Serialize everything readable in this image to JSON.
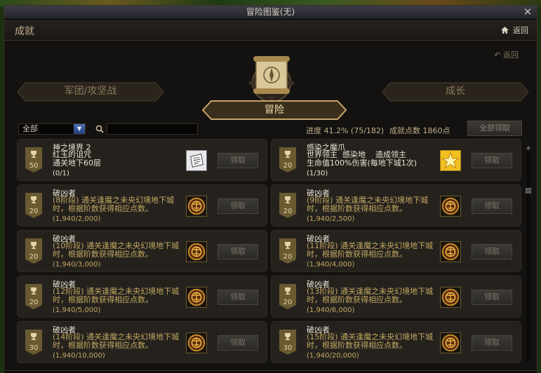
{
  "window": {
    "title": "冒险图鉴(无)"
  },
  "header": {
    "title": "成就",
    "home_label": "返回"
  },
  "return_small": "返回",
  "tabs": {
    "left": "军团/攻坚战",
    "center": "冒险",
    "right": "成长"
  },
  "filter": {
    "select_value": "全部",
    "search_placeholder": "",
    "progress_text": "进度 41.2% (75/182)",
    "points_text": "成就点数 1860点",
    "claim_all_label": "全部领取"
  },
  "cards": [
    {
      "title": "神之境界 2",
      "desc": "红玉的诅咒\n通关地下60层",
      "progress": "(0/1)",
      "points": "50",
      "reward": "scroll-reward-icon",
      "claim": "领取"
    },
    {
      "title": "感染之魔爪",
      "desc": "世界领主  感染地    造成领主\n生命值100%伤害(每地下城1次)",
      "progress": "(1/30)",
      "points": "20",
      "reward": "gold-star-reward-icon",
      "claim": "领取"
    },
    {
      "title": "破凶者",
      "desc": "(8阶段) 通关逢魔之未央幻境地下城时，根据阶数获得相应点数。",
      "progress": "(1,940/2,000)",
      "points": "20",
      "reward": "emblem-reward-icon",
      "claim": "领取"
    },
    {
      "title": "破凶者",
      "desc": "(9阶段) 通关逢魔之未央幻境地下城时，根据阶数获得相应点数。",
      "progress": "(1,940/2,500)",
      "points": "20",
      "reward": "emblem-reward-icon",
      "claim": "领取"
    },
    {
      "title": "破凶者",
      "desc": "(10阶段) 通关逢魔之未央幻境地下城时，根据阶数获得相应点数。",
      "progress": "(1,940/3,000)",
      "points": "20",
      "reward": "emblem-reward-icon",
      "claim": "领取"
    },
    {
      "title": "破凶者",
      "desc": "(11阶段) 通关逢魔之未央幻境地下城时，根据阶数获得相应点数。",
      "progress": "(1,940/4,000)",
      "points": "20",
      "reward": "emblem-reward-icon",
      "claim": "领取"
    },
    {
      "title": "破凶者",
      "desc": "(12阶段) 通关逢魔之未央幻境地下城时，根据阶数获得相应点数。",
      "progress": "(1,940/5,000)",
      "points": "20",
      "reward": "emblem-reward-icon",
      "claim": "领取"
    },
    {
      "title": "破凶者",
      "desc": "(13阶段) 通关逢魔之未央幻境地下城时，根据阶数获得相应点数。",
      "progress": "(1,940/6,000)",
      "points": "20",
      "reward": "emblem-reward-icon",
      "claim": "领取"
    },
    {
      "title": "破凶者",
      "desc": "(14阶段) 通关逢魔之未央幻境地下城时，根据阶数获得相应点数。",
      "progress": "(1,940/10,000)",
      "points": "30",
      "reward": "emblem-reward-icon",
      "claim": "领取"
    },
    {
      "title": "破凶者",
      "desc": "(15阶段) 通关逢魔之未央幻境地下城时，根据阶数获得相应点数。",
      "progress": "(1,940/20,000)",
      "points": "30",
      "reward": "emblem-reward-icon",
      "claim": "领取"
    }
  ],
  "colors": {
    "accent_gold": "#c2a860",
    "panel": "#25221e",
    "text_light": "#e8e2d2"
  }
}
